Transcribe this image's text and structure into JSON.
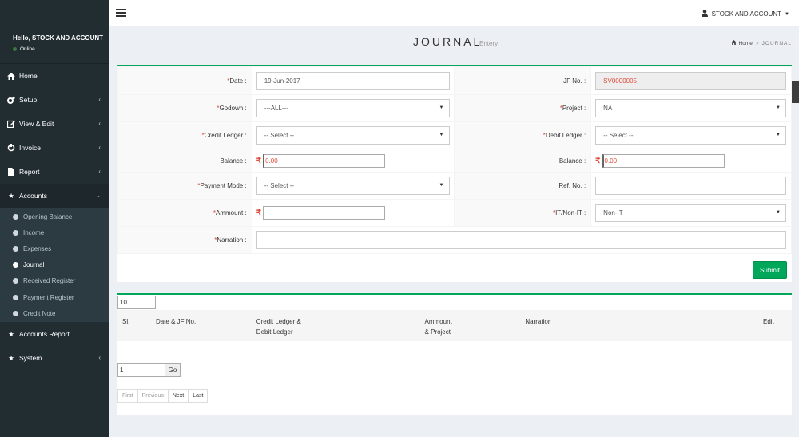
{
  "sidebar": {
    "greeting": "Hello, STOCK AND ACCOUNT",
    "status": "Online",
    "items": [
      {
        "label": "Home",
        "icon": "home-icon",
        "has_chevron": false
      },
      {
        "label": "Setup",
        "icon": "cogs-icon",
        "has_chevron": true
      },
      {
        "label": "View & Edit",
        "icon": "edit-icon",
        "has_chevron": true
      },
      {
        "label": "Invoice",
        "icon": "plug-icon",
        "has_chevron": true
      },
      {
        "label": "Report",
        "icon": "file-icon",
        "has_chevron": true
      },
      {
        "label": "Accounts",
        "icon": "star-icon",
        "has_chevron": true,
        "expanded": true
      },
      {
        "label": "Accounts Report",
        "icon": "star-icon",
        "has_chevron": false
      },
      {
        "label": "System",
        "icon": "star-icon",
        "has_chevron": true
      }
    ],
    "accounts_submenu": [
      "Opening Balance",
      "Income",
      "Expenses",
      "Journal",
      "Received Register",
      "Payment Register",
      "Credit Note"
    ],
    "active_submenu": "Journal"
  },
  "header": {
    "user_label": "STOCK AND ACCOUNT"
  },
  "page": {
    "title": "JOURNAL",
    "subtitle": "Entery",
    "breadcrumb_home": "Home",
    "breadcrumb_current": "JOURNAL"
  },
  "form": {
    "date_label": "Date :",
    "date_value": "19-Jun-2017",
    "jf_label": "JF No. :",
    "jf_value": "SV0000005",
    "godown_label": "Godown :",
    "godown_value": "---ALL---",
    "project_label": "Project :",
    "project_value": "NA",
    "credit_ledger_label": "Credit Ledger :",
    "credit_ledger_value": "-- Select --",
    "debit_ledger_label": "Debit Ledger :",
    "debit_ledger_value": "-- Select --",
    "balance_label": "Balance :",
    "credit_balance": "0.00",
    "debit_balance": "0.00",
    "payment_mode_label": "Payment Mode :",
    "payment_mode_value": "-- Select --",
    "ref_label": "Ref. No. :",
    "ref_value": "",
    "amount_label": "Ammount :",
    "amount_value": "",
    "it_label": "IT/Non-IT :",
    "it_value": "Non-IT",
    "narration_label": "Narration :",
    "narration_value": "",
    "required_mark": "*",
    "rupee_symbol": "₹",
    "submit_label": "Submit"
  },
  "list": {
    "page_size": "10",
    "columns": [
      {
        "line1": "Sl.",
        "line2": ""
      },
      {
        "line1": "Date & JF No.",
        "line2": ""
      },
      {
        "line1": "Credit Ledger &",
        "line2": "Debit Ledger"
      },
      {
        "line1": "Ammount",
        "line2": "& Project"
      },
      {
        "line1": "Narration",
        "line2": ""
      },
      {
        "line1": "Edit",
        "line2": ""
      }
    ],
    "page_number": "1",
    "go_label": "Go",
    "pager": {
      "first": "First",
      "previous": "Previous",
      "next": "Next",
      "last": "Last"
    }
  },
  "colors": {
    "accent_green": "#00a65a",
    "required_red": "#dd4b39",
    "sidebar_bg": "#222d32"
  }
}
